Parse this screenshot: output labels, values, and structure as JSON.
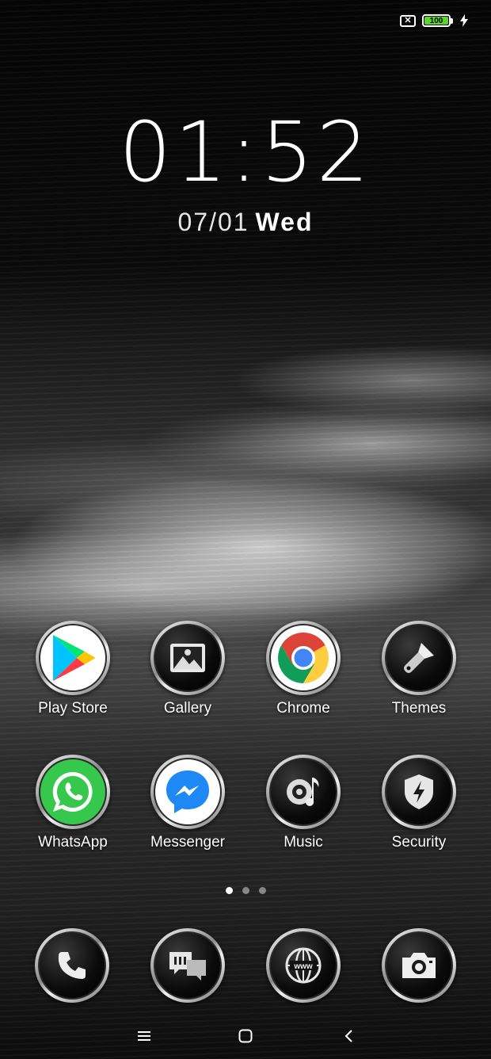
{
  "status_bar": {
    "sim_icon": "no-sim-icon",
    "battery_level": "100",
    "battery_color": "#5ad52c",
    "charging_icon": "bolt-icon"
  },
  "clock": {
    "time": "01:52",
    "date": "07/01",
    "day": "Wed"
  },
  "apps": [
    {
      "label": "Play Store",
      "icon": "play-store-icon"
    },
    {
      "label": "Gallery",
      "icon": "gallery-icon"
    },
    {
      "label": "Chrome",
      "icon": "chrome-icon"
    },
    {
      "label": "Themes",
      "icon": "paintbrush-icon"
    },
    {
      "label": "WhatsApp",
      "icon": "whatsapp-icon"
    },
    {
      "label": "Messenger",
      "icon": "messenger-icon"
    },
    {
      "label": "Music",
      "icon": "music-icon"
    },
    {
      "label": "Security",
      "icon": "shield-icon"
    }
  ],
  "pager": {
    "pages": 3,
    "active": 1
  },
  "dock": [
    {
      "icon": "phone-icon"
    },
    {
      "icon": "messages-icon"
    },
    {
      "icon": "browser-globe-icon",
      "text": "www"
    },
    {
      "icon": "camera-icon"
    }
  ],
  "nav": {
    "menu_icon": "menu-icon",
    "home_icon": "home-icon",
    "back_icon": "back-icon"
  }
}
